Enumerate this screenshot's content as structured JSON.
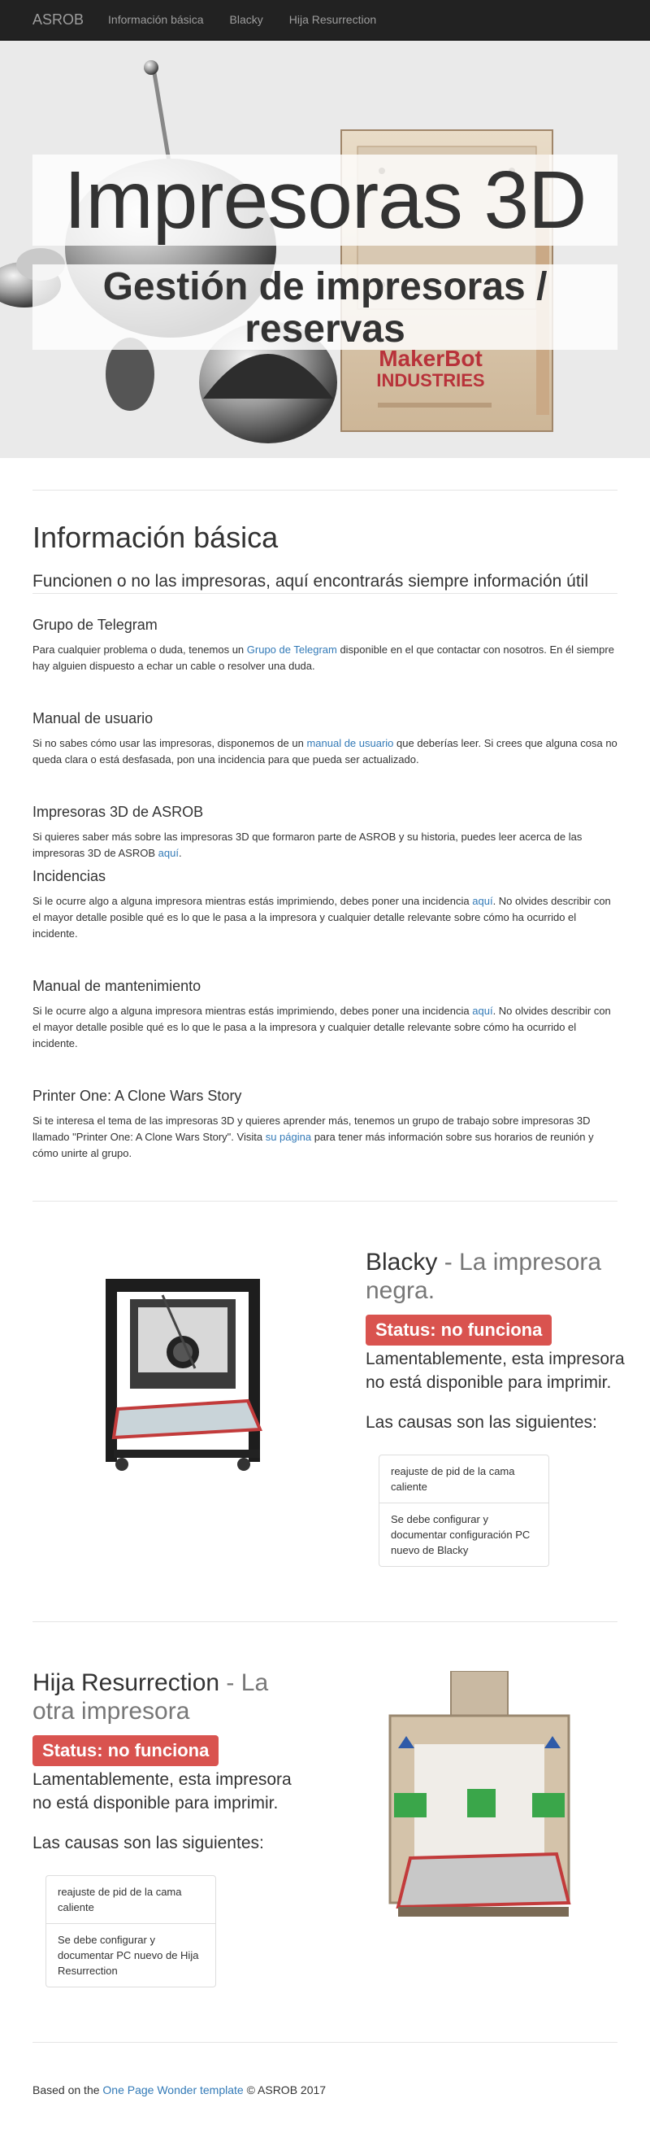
{
  "navbar": {
    "brand": "ASROB",
    "links": [
      "Información básica",
      "Blacky",
      "Hija Resurrection"
    ]
  },
  "hero": {
    "title": "Impresoras 3D",
    "subtitle": "Gestión de impresoras / reservas",
    "sign_text_1": "MakerBot",
    "sign_text_2": "INDUSTRIES"
  },
  "info": {
    "heading": "Información básica",
    "lead": "Funcionen o no las impresoras, aquí encontrarás siempre información útil",
    "telegram": {
      "title": "Grupo de Telegram",
      "text_before": "Para cualquier problema o duda, tenemos un ",
      "link": "Grupo de Telegram",
      "text_after": " disponible en el que contactar con nosotros. En él siempre hay alguien dispuesto a echar un cable o resolver una duda."
    },
    "manual": {
      "title": "Manual de usuario",
      "text_before": "Si no sabes cómo usar las impresoras, disponemos de un ",
      "link": "manual de usuario",
      "text_after": " que deberías leer. Si crees que alguna cosa no queda clara o está desfasada, pon una incidencia para que pueda ser actualizado."
    },
    "asrob": {
      "title": "Impresoras 3D de ASROB",
      "text_before": "Si quieres saber más sobre las impresoras 3D que formaron parte de ASROB y su historia, puedes leer acerca de las impresoras 3D de ASROB ",
      "link": "aquí",
      "text_after": "."
    },
    "incidencias": {
      "title": "Incidencias",
      "text_before": "Si le ocurre algo a alguna impresora mientras estás imprimiendo, debes poner una incidencia ",
      "link": "aquí",
      "text_after": ". No olvides describir con el mayor detalle posible qué es lo que le pasa a la impresora y cualquier detalle relevante sobre cómo ha ocurrido el incidente."
    },
    "mantenimiento": {
      "title": "Manual de mantenimiento",
      "text_before": "Si le ocurre algo a alguna impresora mientras estás imprimiendo, debes poner una incidencia ",
      "link": "aquí",
      "text_after": ". No olvides describir con el mayor detalle posible qué es lo que le pasa a la impresora y cualquier detalle relevante sobre cómo ha ocurrido el incidente."
    },
    "printer_one": {
      "title": "Printer One: A Clone Wars Story",
      "text_before": "Si te interesa el tema de las impresoras 3D y quieres aprender más, tenemos un grupo de trabajo sobre impresoras 3D llamado \"Printer One: A Clone Wars Story\". Visita ",
      "link": "su página",
      "text_after": " para tener más información sobre sus horarios de reunión y cómo unirte al grupo."
    }
  },
  "blacky": {
    "name": "Blacky",
    "sep": " - ",
    "tagline": "La impresora negra.",
    "status": "Status: no funciona",
    "message": "Lamentablemente, esta impresora no está disponible para imprimir.",
    "causes_title": "Las causas son las siguientes:",
    "causes": [
      "reajuste de pid de la cama caliente",
      "Se debe configurar y documentar configuración PC nuevo de Blacky"
    ]
  },
  "hija": {
    "name": "Hija Resurrection",
    "sep": " - ",
    "tagline": "La otra impresora",
    "status": "Status: no funciona",
    "message": "Lamentablemente, esta impresora no está disponible para imprimir.",
    "causes_title": "Las causas son las siguientes:",
    "causes": [
      "reajuste de pid de la cama caliente",
      "Se debe configurar y documentar PC nuevo de Hija Resurrection"
    ]
  },
  "footer": {
    "before": "Based on the ",
    "link": "One Page Wonder template",
    "after": " © ASROB 2017"
  },
  "colors": {
    "navbar_bg": "#222222",
    "status_danger": "#d9534f",
    "link": "#337ab7"
  }
}
